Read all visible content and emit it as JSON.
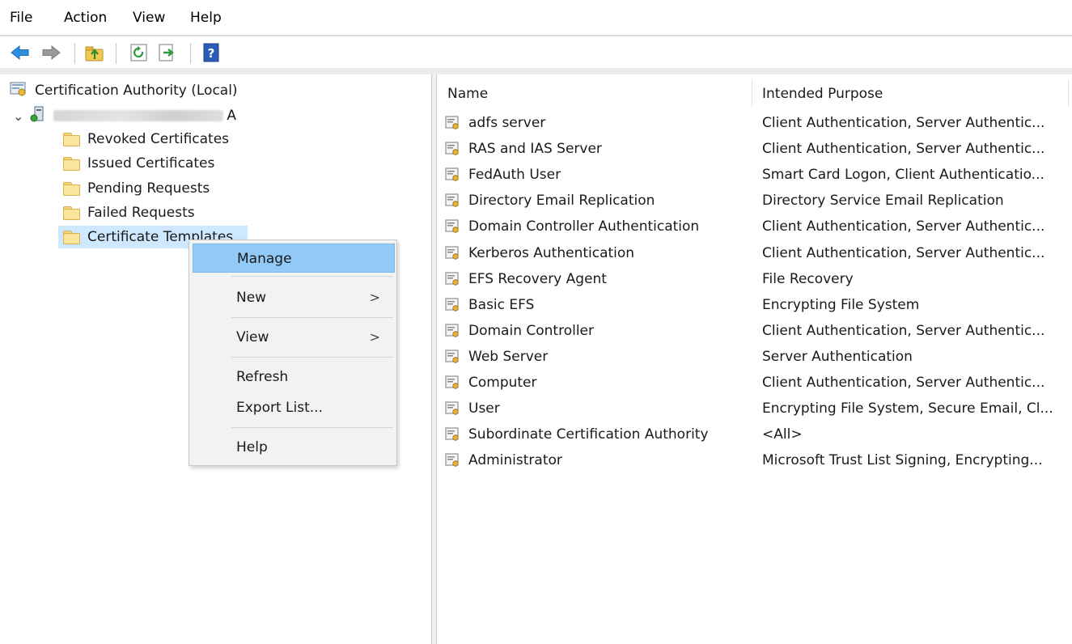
{
  "menu": [
    "File",
    "Action",
    "View",
    "Help"
  ],
  "toolbar": {
    "buttons": [
      "back-icon",
      "forward-icon",
      "up-one-level-icon",
      "refresh-icon",
      "export-list-icon",
      "help-icon"
    ]
  },
  "tree": {
    "root": "Certification Authority (Local)",
    "ca_suffix": "A",
    "items": [
      "Revoked Certificates",
      "Issued Certificates",
      "Pending Requests",
      "Failed Requests",
      "Certificate Templates"
    ],
    "selected": "Certificate Templates"
  },
  "context_menu": {
    "items": [
      {
        "label": "Manage",
        "submenu": ""
      },
      {
        "label": "New",
        "submenu": ">"
      },
      {
        "label": "View",
        "submenu": ">"
      },
      {
        "label": "Refresh",
        "submenu": ""
      },
      {
        "label": "Export List...",
        "submenu": ""
      },
      {
        "label": "Help",
        "submenu": ""
      }
    ],
    "highlighted": "Manage"
  },
  "list": {
    "columns": [
      "Name",
      "Intended Purpose"
    ],
    "rows": [
      {
        "name": "adfs server",
        "purpose": "Client Authentication, Server Authentic..."
      },
      {
        "name": "RAS and IAS Server",
        "purpose": "Client Authentication, Server Authentic..."
      },
      {
        "name": "FedAuth User",
        "purpose": "Smart Card Logon, Client Authenticatio..."
      },
      {
        "name": "Directory Email Replication",
        "purpose": "Directory Service Email Replication"
      },
      {
        "name": "Domain Controller Authentication",
        "purpose": "Client Authentication, Server Authentic..."
      },
      {
        "name": "Kerberos Authentication",
        "purpose": "Client Authentication, Server Authentic..."
      },
      {
        "name": "EFS Recovery Agent",
        "purpose": "File Recovery"
      },
      {
        "name": "Basic EFS",
        "purpose": "Encrypting File System"
      },
      {
        "name": "Domain Controller",
        "purpose": "Client Authentication, Server Authentic..."
      },
      {
        "name": "Web Server",
        "purpose": "Server Authentication"
      },
      {
        "name": "Computer",
        "purpose": "Client Authentication, Server Authentic..."
      },
      {
        "name": "User",
        "purpose": "Encrypting File System, Secure Email, Cl..."
      },
      {
        "name": "Subordinate Certification Authority",
        "purpose": "<All>"
      },
      {
        "name": "Administrator",
        "purpose": "Microsoft Trust List Signing, Encrypting..."
      }
    ]
  },
  "colors": {
    "selection": "#cde8ff",
    "menu_highlight": "#91c9f7",
    "menu_bg": "#f2f2f2"
  }
}
